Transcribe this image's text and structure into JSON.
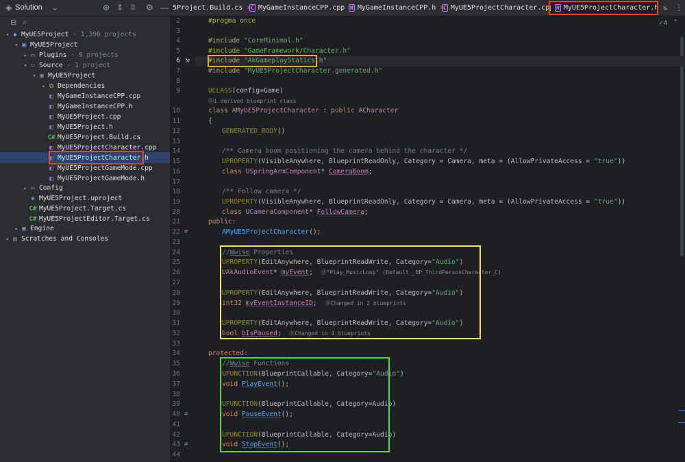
{
  "toolbar": {
    "solution_label": "Solution",
    "tabs": [
      {
        "label": "5Project.Build.cs"
      },
      {
        "label": "MyGameInstanceCPP.cpp"
      },
      {
        "label": "MyGameInstanceCPP.h"
      },
      {
        "label": "MyUE5ProjectCharacter.cpp"
      },
      {
        "label": "MyUE5ProjectCharacter.h"
      }
    ],
    "inspection_count": "4"
  },
  "tree": [
    {
      "label": "MyUE5Project",
      "meta": "1,390 projects"
    },
    {
      "label": "MyUE5Project",
      "meta": ""
    },
    {
      "label": "Plugins",
      "meta": "9 projects"
    },
    {
      "label": "Source",
      "meta": "1 project"
    },
    {
      "label": "MyUE5Project",
      "meta": ""
    },
    {
      "label": "Dependencies",
      "meta": ""
    },
    {
      "label": "MyGameInstanceCPP.cpp",
      "meta": ""
    },
    {
      "label": "MyGameInstanceCPP.h",
      "meta": ""
    },
    {
      "label": "MyUE5Project.cpp",
      "meta": ""
    },
    {
      "label": "MyUE5Project.h",
      "meta": ""
    },
    {
      "label": "MyUE5Project.Build.cs",
      "meta": ""
    },
    {
      "label": "MyUE5ProjectCharacter.cpp",
      "meta": ""
    },
    {
      "label": "MyUE5ProjectCharacter.h",
      "meta": ""
    },
    {
      "label": "MyUE5ProjectGameMode.cpp",
      "meta": ""
    },
    {
      "label": "MyUE5ProjectGameMode.h",
      "meta": ""
    },
    {
      "label": "Config",
      "meta": ""
    },
    {
      "label": "MyUE5Project.uproject",
      "meta": ""
    },
    {
      "label": "MyUE5Project.Target.cs",
      "meta": ""
    },
    {
      "label": "MyUE5ProjectEditor.Target.cs",
      "meta": ""
    },
    {
      "label": "Engine",
      "meta": ""
    },
    {
      "label": "Scratches and Consoles",
      "meta": ""
    }
  ],
  "editor": {
    "line_numbers": [
      "2",
      "3",
      "4",
      "5",
      "6",
      "7",
      "8",
      "9",
      "",
      "10",
      "11",
      "12",
      "13",
      "14",
      "15",
      "16",
      "17",
      "18",
      "19",
      "20",
      "21",
      "22",
      "23",
      "24",
      "25",
      "26",
      "27",
      "28",
      "29",
      "30",
      "31",
      "32",
      "33",
      "34",
      "35",
      "36",
      "37",
      "38",
      "39",
      "40",
      "41",
      "42",
      "43",
      "44"
    ],
    "code": {
      "l2": "#pragma once",
      "l4a": "#include ",
      "l4b": "\"CoreMinimal.h\"",
      "l5a": "#include ",
      "l5b": "\"GameFramework/Character.h\"",
      "l6a": "#include ",
      "l6b": "\"AkGameplayStatics.h\"",
      "l7a": "#include ",
      "l7b": "\"MyUE5ProjectCharacter.generated.h\"",
      "l9a": "UCLASS",
      "l9b": "(config=Game)",
      "hint9": "1 derived blueprint class",
      "l10a": "class ",
      "l10b": "AMyUE5ProjectCharacter",
      "l10c": " : ",
      "l10d": "public ",
      "l10e": "ACharacter",
      "l11": "{",
      "l12a": "GENERATED_BODY",
      "l12b": "()",
      "l14": "/** Camera boom positioning the camera behind the character */",
      "l15a": "UPROPERTY",
      "l15b": "(VisibleAnywhere, BlueprintReadOnly, Category = Camera, meta = (AllowPrivateAccess = ",
      "l15c": "\"true\"",
      "l15d": "))",
      "l16a": "class ",
      "l16b": "USpringArmComponent",
      "l16c": "* ",
      "l16d": "CameraBoom",
      "l16e": ";",
      "l18": "/** Follow camera */",
      "l19a": "UPROPERTY",
      "l19b": "(VisibleAnywhere, BlueprintReadOnly, Category = Camera, meta = (AllowPrivateAccess = ",
      "l19c": "\"true\"",
      "l19d": "))",
      "l20a": "class ",
      "l20b": "UCameraComponent",
      "l20c": "* ",
      "l20d": "FollowCamera",
      "l20e": ";",
      "l21": "public:",
      "l22a": "AMyUE5ProjectCharacter",
      "l22b": "();",
      "l24a": "//",
      "l24b": "Wwise",
      "l24c": " Properties",
      "l25a": "UPROPERTY",
      "l25b": "(EditAnywhere, BlueprintReadWrite, Category=",
      "l25c": "\"Audio\"",
      "l25d": ")",
      "l26a": "UAkAudioEvent",
      "l26b": "* ",
      "l26c": "myEvent",
      "l26d": ";",
      "hint26": "\"Play_MusicLoop\" (Default__BP_ThirdPersonCharacter_C)",
      "l28a": "UPROPERTY",
      "l28b": "(EditAnywhere, BlueprintReadWrite, Category=",
      "l28c": "\"Audio\"",
      "l28d": ")",
      "l29a": "int32 ",
      "l29b": "myEventInstanceID",
      "l29c": ";",
      "hint29": "Changed in 2 blueprints",
      "l31a": "UPROPERTY",
      "l31b": "(EditAnywhere, BlueprintReadWrite, Category=",
      "l31c": "\"Audio\"",
      "l31d": ")",
      "l32a": "bool ",
      "l32b": "bIsPaused",
      "l32c": ";",
      "hint32": "Changed in 4 blueprints",
      "l34": "protected:",
      "l35a": "//",
      "l35b": "Wwise",
      "l35c": " Functions",
      "l36a": "UFUNCTION",
      "l36b": "(BlueprintCallable, Category=",
      "l36c": "\"Audio\"",
      "l36d": ")",
      "l37a": "void ",
      "l37b": "PlayEvent",
      "l37c": "();",
      "l39a": "UFUNCTION",
      "l39b": "(BlueprintCallable, Category=Audio)",
      "l40a": "void ",
      "l40b": "PauseEvent",
      "l40c": "();",
      "l42a": "UFUNCTION",
      "l42b": "(BlueprintCallable, Category=Audio)",
      "l43a": "void ",
      "l43b": "StopEvent",
      "l43c": "();"
    }
  },
  "colors": {
    "highlight_red": "#e8451e",
    "highlight_orange": "#f0a530",
    "highlight_yellow": "#f2e64c",
    "highlight_green": "#5fd33b"
  }
}
